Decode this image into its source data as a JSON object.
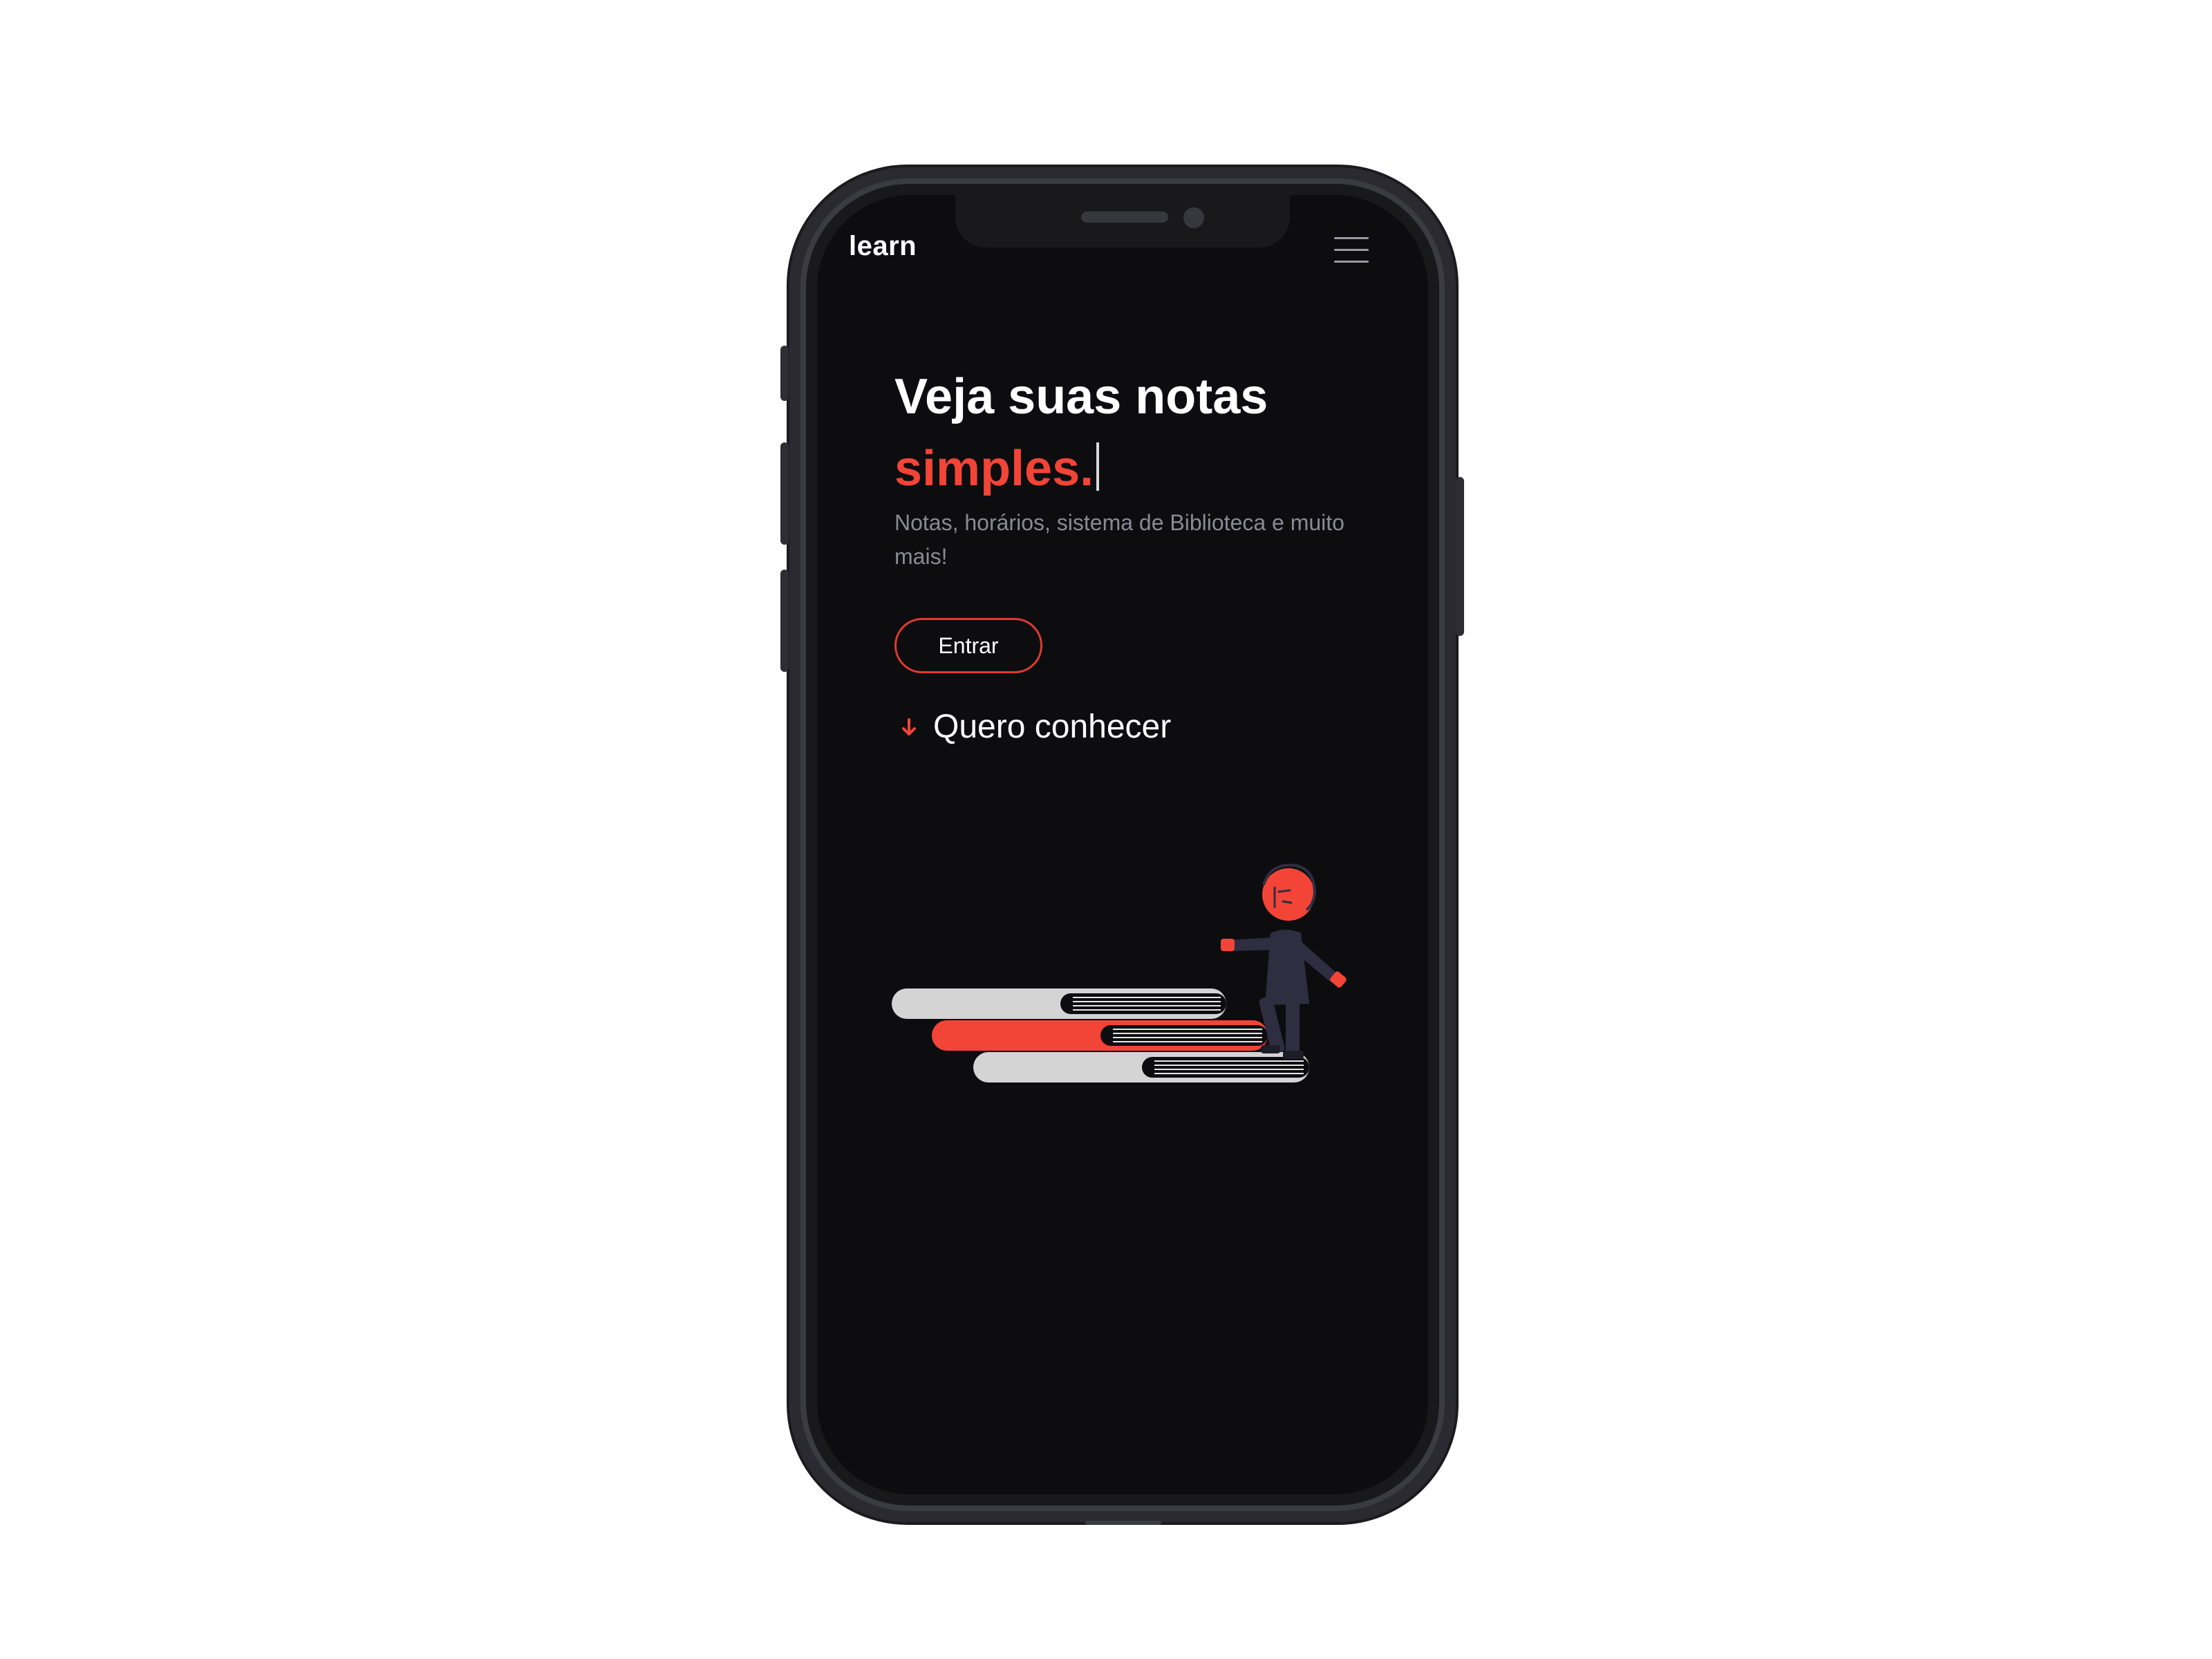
{
  "header": {
    "logo": "learn",
    "menu_icon": "hamburger-menu-icon"
  },
  "hero": {
    "title": "Veja suas notas",
    "accent_text": "simples.",
    "subtitle": "Notas, horários, sistema de Biblioteca e muito mais!",
    "enter_label": "Entrar",
    "discover_label": "Quero conhecer",
    "discover_icon": "arrow-down-icon"
  },
  "illustration": {
    "name": "person-climbing-books",
    "colors": {
      "accent": "#f24437",
      "book_light": "#d4d4d4",
      "figure": "#2f2e41"
    }
  },
  "colors": {
    "background": "#0d0d10",
    "accent": "#f24437",
    "muted_text": "#8a8a94",
    "text": "#ffffff"
  }
}
